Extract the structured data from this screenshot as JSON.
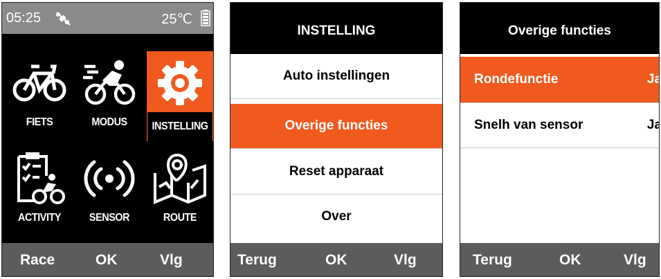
{
  "colors": {
    "accent": "#f05a1f",
    "status_bar": "#8a8a8a",
    "soft_bar": "#5c5c5c"
  },
  "screen1": {
    "status": {
      "time": "05:25",
      "temperature": "25℃",
      "gps_icon": "gps-off-icon",
      "battery_icon": "battery-icon"
    },
    "tiles": [
      {
        "label": "FIETS",
        "icon": "bike-icon"
      },
      {
        "label": "MODUS",
        "icon": "cyclist-icon"
      },
      {
        "label": "INSTELLING",
        "icon": "gear-icon"
      },
      {
        "label": "ACTIVITY",
        "icon": "activity-clipboard-icon"
      },
      {
        "label": "SENSOR",
        "icon": "sensor-signal-icon"
      },
      {
        "label": "ROUTE",
        "icon": "map-pin-icon"
      }
    ],
    "softkeys": {
      "left": "Race",
      "center": "OK",
      "right": "Vlg"
    }
  },
  "screen2": {
    "title": "INSTELLING",
    "items": [
      "Auto instellingen",
      "Overige functies",
      "Reset apparaat",
      "Over"
    ],
    "softkeys": {
      "left": "Terug",
      "center": "OK",
      "right": "Vlg"
    }
  },
  "screen3": {
    "title": "Overige functies",
    "items": [
      {
        "label": "Rondefunctie",
        "value": "Ja"
      },
      {
        "label": "Snelh van sensor",
        "value": "Ja"
      }
    ],
    "softkeys": {
      "left": "Terug",
      "center": "OK",
      "right": "Vlg"
    }
  }
}
